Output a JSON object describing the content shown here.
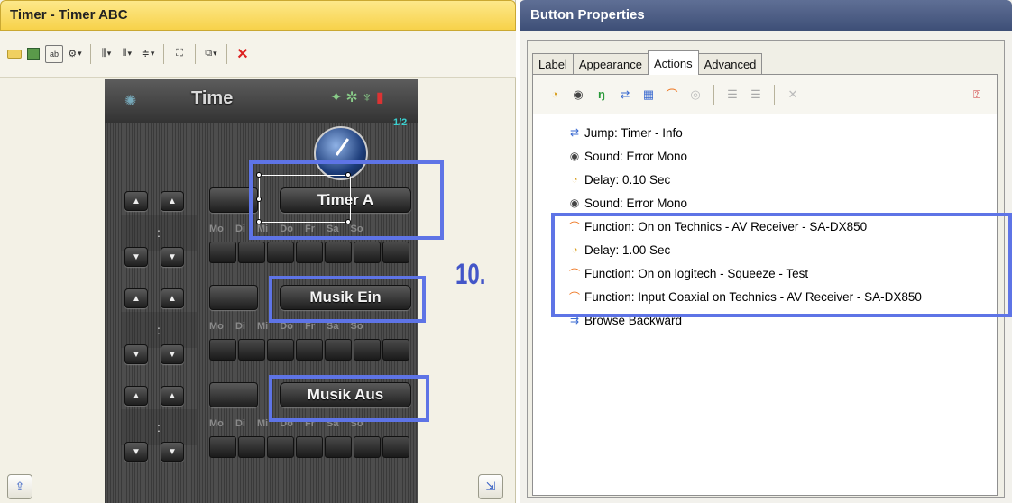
{
  "left_panel": {
    "title": "Timer - Timer ABC",
    "toolbar_icons": [
      "label-icon",
      "image-icon",
      "frame-icon",
      "settings-icon",
      "align-horizontal-icon",
      "distribute-icon",
      "align-vertical-icon",
      "fit-icon",
      "group-icon",
      "delete-icon"
    ],
    "phone": {
      "title": "Time",
      "page_counter": "1/2",
      "buttons": [
        {
          "label": "Timer A"
        },
        {
          "label": "Musik Ein"
        },
        {
          "label": "Musik Aus"
        }
      ],
      "days": "Mo Di Mi Do Fr Sa So",
      "colon": ":"
    },
    "step_label": "10."
  },
  "right_panel": {
    "title": "Button Properties",
    "tabs": [
      "Label",
      "Appearance",
      "Actions",
      "Advanced"
    ],
    "active_tab": "Actions",
    "actions": [
      {
        "icon": "jump-icon",
        "text": "Jump: Timer - Info"
      },
      {
        "icon": "sound-icon",
        "text": "Sound: Error Mono"
      },
      {
        "icon": "delay-icon",
        "text": "Delay: 0.10 Sec"
      },
      {
        "icon": "sound-icon",
        "text": "Sound: Error Mono"
      },
      {
        "icon": "function-icon",
        "text": "Function: On on Technics - AV Receiver - SA-DX850"
      },
      {
        "icon": "delay-icon",
        "text": "Delay: 1.00 Sec"
      },
      {
        "icon": "function-icon",
        "text": "Function: On on logitech - Squeeze - Test"
      },
      {
        "icon": "function-icon",
        "text": "Function: Input Coaxial on Technics - AV Receiver - SA-DX850"
      },
      {
        "icon": "browse-icon",
        "text": "Browse Backward"
      }
    ]
  },
  "colors": {
    "highlight": "#5e74e6",
    "title_bar_left": "#f7d24a",
    "title_bar_right": "#3e4f77"
  }
}
